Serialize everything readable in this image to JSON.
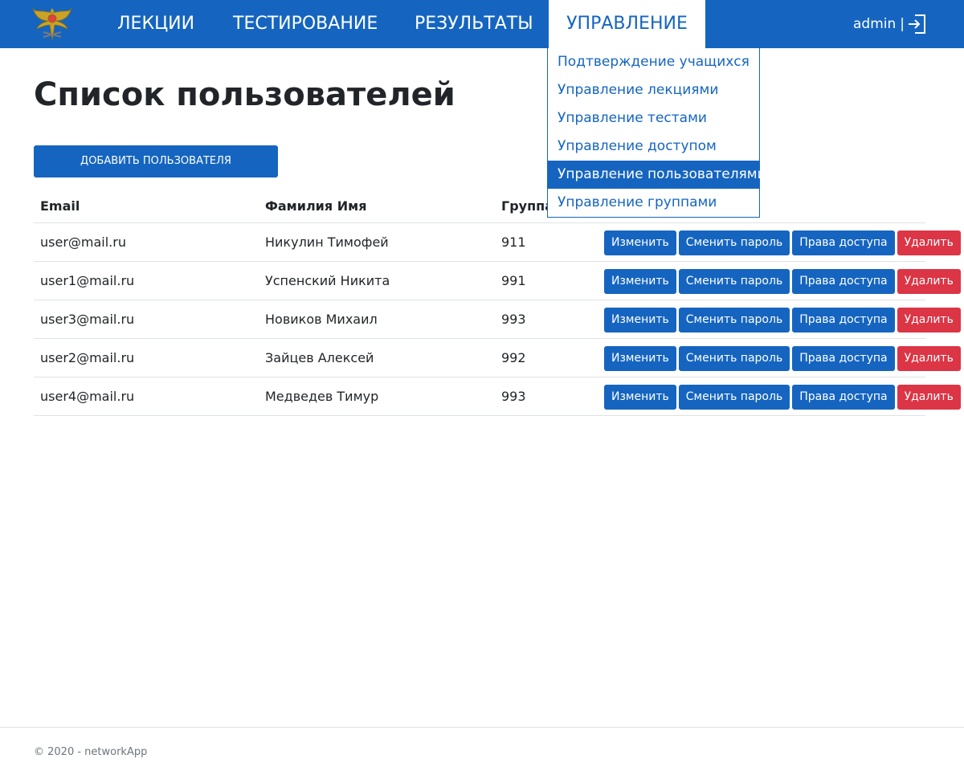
{
  "nav": {
    "items": [
      {
        "label": "Лекции"
      },
      {
        "label": "Тестирование"
      },
      {
        "label": "Результаты"
      },
      {
        "label": "Управление"
      }
    ],
    "username": "admin",
    "separator": "|"
  },
  "dropdown": {
    "items": [
      {
        "label": "Подтверждение учащихся"
      },
      {
        "label": "Управление лекциями"
      },
      {
        "label": "Управление тестами"
      },
      {
        "label": "Управление доступом"
      },
      {
        "label": "Управление пользователями",
        "active": true
      },
      {
        "label": "Управление группами"
      }
    ]
  },
  "page": {
    "title": "Список пользователей",
    "add_button": "Добавить пользователя"
  },
  "table": {
    "headers": {
      "email": "Email",
      "name": "Фамилия Имя",
      "group": "Группа"
    },
    "rows": [
      {
        "email": "user@mail.ru",
        "name": "Никулин Тимофей",
        "group": "911"
      },
      {
        "email": "user1@mail.ru",
        "name": "Успенский Никита",
        "group": "991"
      },
      {
        "email": "user3@mail.ru",
        "name": "Новиков Михаил",
        "group": "993"
      },
      {
        "email": "user2@mail.ru",
        "name": "Зайцев Алексей",
        "group": "992"
      },
      {
        "email": "user4@mail.ru",
        "name": "Медведев Тимур",
        "group": "993"
      }
    ],
    "actions": {
      "edit": "Изменить",
      "password": "Сменить пароль",
      "access": "Права доступа",
      "delete": "Удалить"
    }
  },
  "footer": {
    "text": "© 2020 - networkApp"
  },
  "colors": {
    "primary": "#1565c0",
    "danger": "#dc3545",
    "logo_gold": "#c9a227"
  },
  "icons": {
    "logo": "eagle-emblem-icon",
    "logout": "logout-icon"
  }
}
